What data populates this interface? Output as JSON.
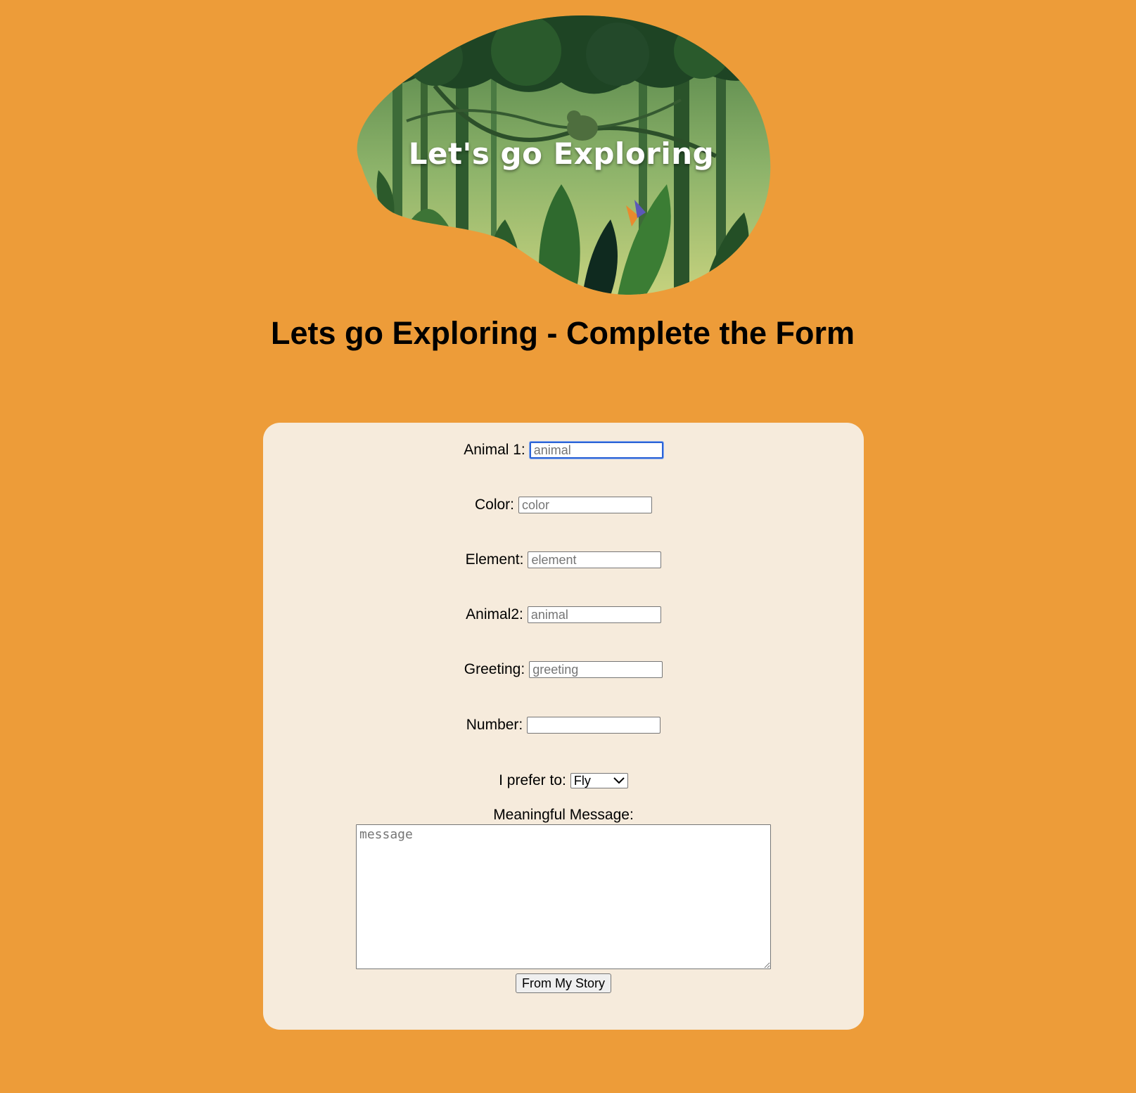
{
  "hero": {
    "title": "Let's go Exploring"
  },
  "page_title": "Lets go Exploring - Complete the Form",
  "form": {
    "fields": [
      {
        "label": "Animal 1:",
        "placeholder": "animal",
        "value": ""
      },
      {
        "label": "Color:",
        "placeholder": "color",
        "value": ""
      },
      {
        "label": "Element:",
        "placeholder": "element",
        "value": ""
      },
      {
        "label": "Animal2:",
        "placeholder": "animal",
        "value": ""
      },
      {
        "label": "Greeting:",
        "placeholder": "greeting",
        "value": ""
      },
      {
        "label": "Number:",
        "placeholder": "",
        "value": ""
      }
    ],
    "prefer": {
      "label": "I prefer to:",
      "selected": "Fly"
    },
    "message": {
      "label": "Meaningful Message:",
      "placeholder": "message"
    },
    "submit_label": "From My Story"
  },
  "colors": {
    "background": "#ED9C39",
    "card": "#F6EBDC",
    "focus": "#2B63D6"
  },
  "icons": {
    "select_arrow": "chevron-down-icon"
  }
}
